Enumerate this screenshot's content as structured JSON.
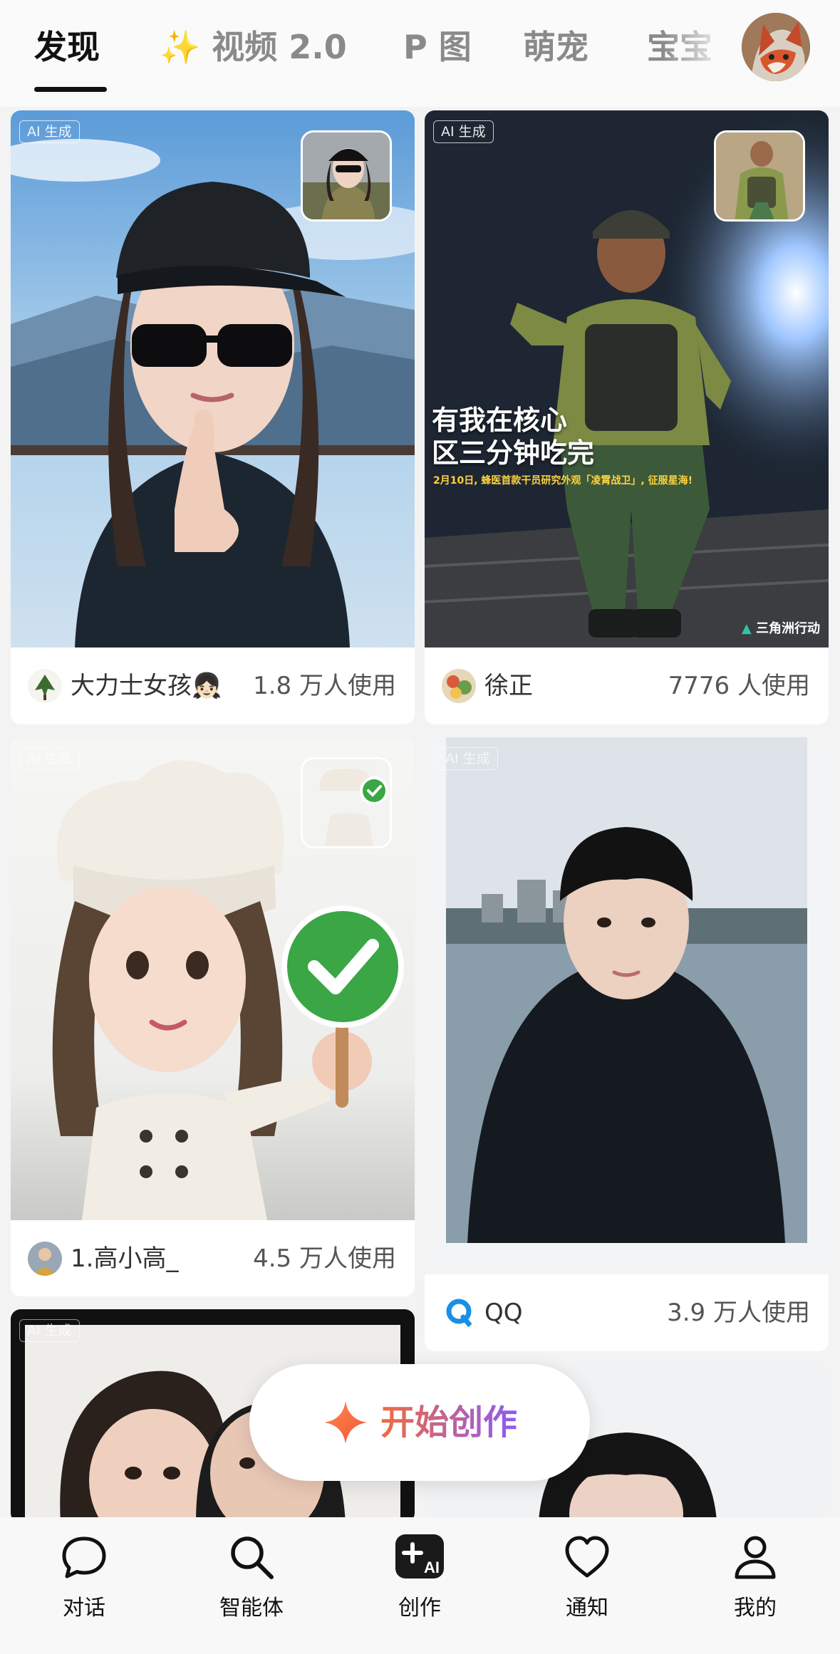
{
  "tabs": [
    {
      "label": "发现",
      "active": true
    },
    {
      "label": "✨ 视频 2.0",
      "active": false
    },
    {
      "label": "P 图",
      "active": false
    },
    {
      "label": "萌宠",
      "active": false
    },
    {
      "label": "宝宝",
      "active": false
    }
  ],
  "feed": {
    "ai_badge": "AI 生成",
    "cards": [
      {
        "user": "大力士女孩👧🏻",
        "uses": "1.8 万人使用",
        "subject": "girl-in-cap-pointing"
      },
      {
        "user": "徐正",
        "uses": "7776 人使用",
        "subject": "soldier-3d-character",
        "poster_headline_1": "有我在核心",
        "poster_headline_2": "区三分钟吃完",
        "poster_subline": "2月10日, 蜂医首款干员研究外观「凌霄战卫」, 征服星海!",
        "poster_brand": "三角洲行动"
      },
      {
        "user": "1.高小高_",
        "uses": "4.5 万人使用",
        "subject": "chef-girl-3d"
      },
      {
        "user": "QQ",
        "uses": "3.9 万人使用",
        "subject": "young-man-lakeside"
      }
    ]
  },
  "create_button": {
    "label": "开始创作"
  },
  "bottom_nav": [
    {
      "label": "对话",
      "icon": "chat-bubble-icon"
    },
    {
      "label": "智能体",
      "icon": "search-icon"
    },
    {
      "label": "创作",
      "icon": "create-ai-icon"
    },
    {
      "label": "通知",
      "icon": "heart-icon"
    },
    {
      "label": "我的",
      "icon": "person-icon"
    }
  ],
  "colors": {
    "accent_orange": "#f26a3c",
    "accent_purple": "#8b5cf6",
    "text_primary": "#111111"
  }
}
